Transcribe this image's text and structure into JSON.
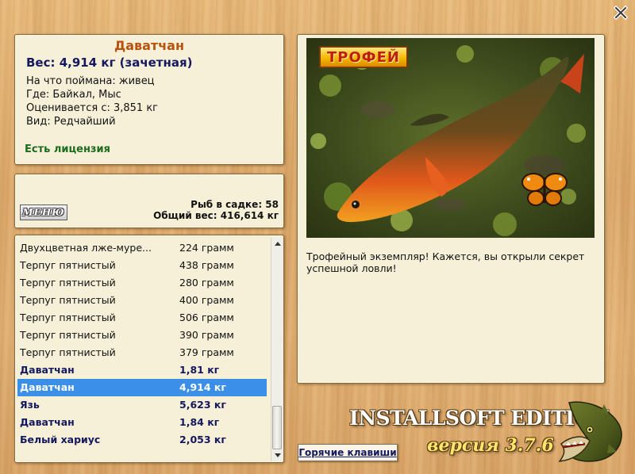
{
  "window": {
    "close_label": "X"
  },
  "fish": {
    "name": "Даватчан",
    "weight": "Вес: 4,914 кг (зачетная)",
    "bait": "На что поймана: живец",
    "location": "Где: Байкал, Мыс",
    "rated_from": "Оценивается с: 3,851 кг",
    "type": "Вид: Редчайший",
    "license": "Есть лицензия"
  },
  "stats": {
    "menu_label": "МЕНЮ",
    "fish_in_keepnet": "Рыб в садке: 58",
    "total_weight": "Общий вес: 416,614 кг"
  },
  "catch_list": [
    {
      "name": "Двухцветная лже-муре...",
      "weight": "224 грамм",
      "trophy": false,
      "selected": false
    },
    {
      "name": "Терпуг пятнистый",
      "weight": "438 грамм",
      "trophy": false,
      "selected": false
    },
    {
      "name": "Терпуг пятнистый",
      "weight": "280 грамм",
      "trophy": false,
      "selected": false
    },
    {
      "name": "Терпуг пятнистый",
      "weight": "400 грамм",
      "trophy": false,
      "selected": false
    },
    {
      "name": "Терпуг пятнистый",
      "weight": "506 грамм",
      "trophy": false,
      "selected": false
    },
    {
      "name": "Терпуг пятнистый",
      "weight": "390 грамм",
      "trophy": false,
      "selected": false
    },
    {
      "name": "Терпуг пятнистый",
      "weight": "379 грамм",
      "trophy": false,
      "selected": false
    },
    {
      "name": "Даватчан",
      "weight": "1,81 кг",
      "trophy": true,
      "selected": false
    },
    {
      "name": "Даватчан",
      "weight": "4,914 кг",
      "trophy": true,
      "selected": true
    },
    {
      "name": "Язь",
      "weight": "5,623 кг",
      "trophy": true,
      "selected": false
    },
    {
      "name": "Даватчан",
      "weight": "1,84 кг",
      "trophy": true,
      "selected": false
    },
    {
      "name": "Белый хариус",
      "weight": "2,053 кг",
      "trophy": true,
      "selected": false
    }
  ],
  "trophy": {
    "badge": "ТРОФЕЙ",
    "description": "Трофейный экземпляр! Кажется, вы открыли секрет успешной ловли!"
  },
  "footer": {
    "hotkeys": "Горячие клавиши",
    "edition": "INSTALLSOFT EDITION",
    "version": "версия 3.7.6"
  },
  "colors": {
    "trophy_text": "#14185e",
    "selected_row": "#3b8fe6",
    "fish_name": "#b8520c",
    "license": "#1d6b1d"
  }
}
